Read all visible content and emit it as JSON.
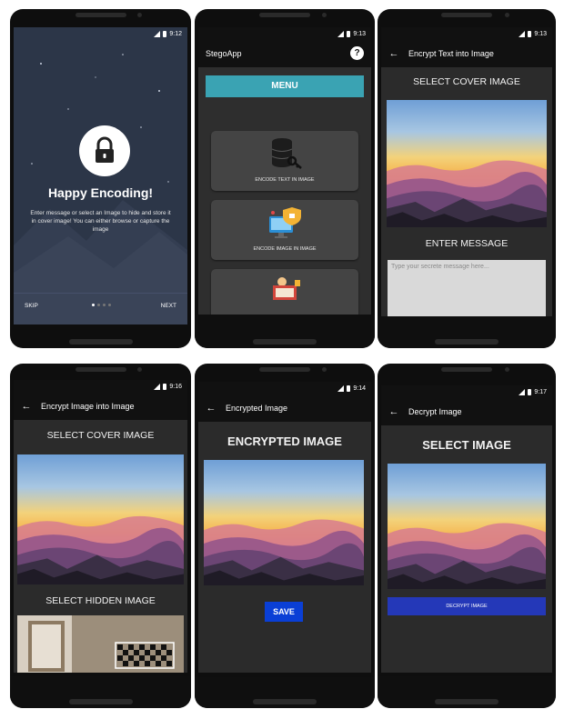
{
  "status_times": [
    "9:12",
    "9:13",
    "9:13",
    "9:16",
    "9:14",
    "9:17"
  ],
  "intro": {
    "title": "Happy Encoding!",
    "description": "Enter message or select an Image to hide and store it in cover image! You can either browse or capture the image",
    "skip": "SKIP",
    "next": "NEXT",
    "page_indicator": {
      "total": 4,
      "current": 1
    }
  },
  "menu_screen": {
    "app_name": "StegoApp",
    "help_icon": "?",
    "menu_button": "MENU",
    "cards": [
      {
        "label": "ENCODE TEXT IN IMAGE",
        "icon": "database-key-icon"
      },
      {
        "label": "ENCODE IMAGE IN IMAGE",
        "icon": "monitor-shield-icon"
      },
      {
        "label": "",
        "icon": "binary-display-icon"
      }
    ]
  },
  "encrypt_text": {
    "title": "Encrypt Text into Image",
    "select_cover": "SELECT COVER IMAGE",
    "enter_message": "ENTER MESSAGE",
    "message_placeholder": "Type your secrete message here..."
  },
  "encrypt_image": {
    "title": "Encrypt Image into Image",
    "select_cover": "SELECT COVER IMAGE",
    "select_hidden": "SELECT HIDDEN IMAGE"
  },
  "encrypted": {
    "title": "Encrypted Image",
    "heading": "ENCRYPTED IMAGE",
    "save": "SAVE"
  },
  "decrypt": {
    "title": "Decrypt Image",
    "heading": "SELECT IMAGE",
    "decrypt_button": "DECRYPT IMAGE"
  },
  "colors": {
    "menu_accent": "#3aa3b3",
    "save_button": "#0a3fd6",
    "decrypt_button": "#2438b8",
    "intro_bg": "#2c3648"
  }
}
